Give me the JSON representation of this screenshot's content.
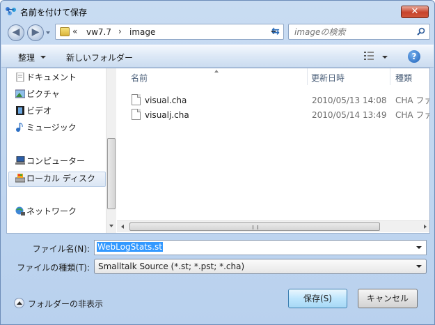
{
  "window": {
    "title": "名前を付けて保存",
    "close_label": "✕"
  },
  "address": {
    "chevrons": "«",
    "crumbs": [
      "vw7.7",
      "image"
    ],
    "separator": "›"
  },
  "search": {
    "placeholder": "imageの検索"
  },
  "toolbar": {
    "organize_label": "整理",
    "new_folder_label": "新しいフォルダー",
    "help_label": "?"
  },
  "sidebar": {
    "items": [
      {
        "label": "ドキュメント",
        "icon": "document-icon"
      },
      {
        "label": "ピクチャ",
        "icon": "pictures-icon"
      },
      {
        "label": "ビデオ",
        "icon": "video-icon"
      },
      {
        "label": "ミュージック",
        "icon": "music-icon"
      },
      {
        "label": "コンピューター",
        "icon": "computer-icon"
      },
      {
        "label": "ローカル ディスク",
        "icon": "local-disk-icon"
      },
      {
        "label": "ネットワーク",
        "icon": "network-icon"
      }
    ]
  },
  "file_list": {
    "columns": [
      "名前",
      "更新日時",
      "種類"
    ],
    "rows": [
      {
        "name": "visual.cha",
        "modified": "2010/05/13 14:08",
        "type": "CHA ファ"
      },
      {
        "name": "visualj.cha",
        "modified": "2010/05/14 13:49",
        "type": "CHA ファ"
      }
    ]
  },
  "form": {
    "filename_label": "ファイル名(N):",
    "filename_value": "WebLogStats.st",
    "filetype_label": "ファイルの種類(T):",
    "filetype_value": "Smalltalk Source (*.st; *.pst; *.cha)"
  },
  "footer": {
    "hide_folders_label": "フォルダーの非表示",
    "save_label": "保存(S)",
    "cancel_label": "キャンセル"
  },
  "colors": {
    "accent": "#3399ff",
    "titlebar": "#c9dcf2",
    "close": "#c7432b"
  }
}
